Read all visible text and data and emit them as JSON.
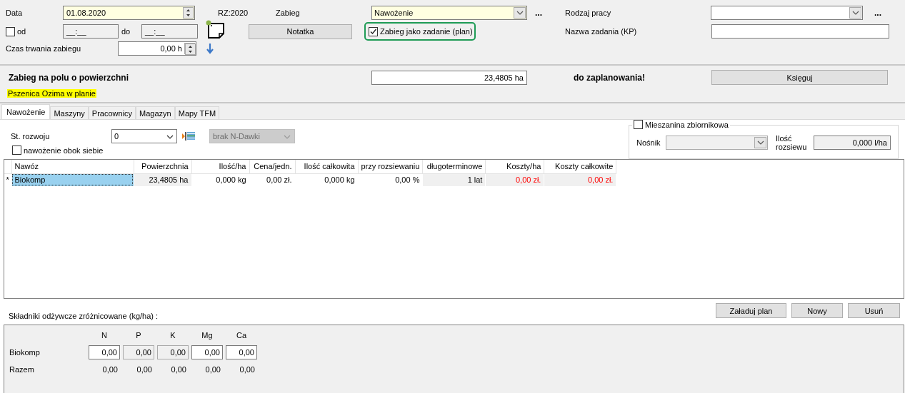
{
  "form": {
    "date": {
      "label": "Data",
      "value": "01.08.2020"
    },
    "year": "RZ:2020",
    "treatment": {
      "label": "Zabieg",
      "value": "Nawożenie",
      "more": "..."
    },
    "work_type": {
      "label": "Rodzaj pracy",
      "more": "..."
    },
    "from": {
      "label": "od",
      "checked": false,
      "value": "__:__"
    },
    "to": {
      "label": "do",
      "value": "__:__"
    },
    "note_button": "Notatka",
    "as_task": {
      "label": "Zabieg jako zadanie (plan)",
      "checked": true
    },
    "task_name": {
      "label": "Nazwa zadania (KP)"
    },
    "duration": {
      "label": "Czas trwania zabiegu",
      "value": "0,00 h"
    }
  },
  "area": {
    "label": "Zabieg na polu o powierzchni",
    "value": "23,4805 ha",
    "status": "do zaplanowania!",
    "post_button": "Księguj",
    "crop": "Pszenica Ozima w planie"
  },
  "tabs": [
    {
      "label": "Nawożenie",
      "selected": true
    },
    {
      "label": "Maszyny",
      "selected": false
    },
    {
      "label": "Pracownicy",
      "selected": false
    },
    {
      "label": "Magazyn",
      "selected": false
    },
    {
      "label": "Mapy TFM",
      "selected": false
    }
  ],
  "fertilization": {
    "growth_stage": {
      "label": "St. rozwoju",
      "value": "0"
    },
    "n_dose": {
      "value": "brak N-Dawki",
      "disabled": true
    },
    "side_by_side": {
      "label": "nawożenie obok siebie",
      "checked": false
    },
    "tank_mix": {
      "label": "Mieszanina zbiornikowa",
      "checked": false,
      "carrier_label": "Nośnik",
      "amount_label": "Ilość rozsiewu",
      "amount": "0,000 l/ha"
    }
  },
  "table": {
    "columns": [
      "Nawóz",
      "Powierzchnia",
      "Ilość/ha",
      "Cena/jedn.",
      "Ilość całkowita",
      "przy rozsiewaniu",
      "długoterminowe",
      "Koszty/ha",
      "Koszty całkowite"
    ],
    "rows": [
      {
        "marker": "*",
        "cells": [
          {
            "text": "Biokomp",
            "kind": "selected"
          },
          {
            "text": "23,4805 ha",
            "kind": "readonly"
          },
          {
            "text": "0,000 kg",
            "kind": "editable"
          },
          {
            "text": "0,00 zł.",
            "kind": "editable"
          },
          {
            "text": "0,000 kg",
            "kind": "editable"
          },
          {
            "text": "0,00 %",
            "kind": "editable"
          },
          {
            "text": "1 lat",
            "kind": "readonly"
          },
          {
            "text": "0,00 zł.",
            "kind": "cost"
          },
          {
            "text": "0,00 zł.",
            "kind": "cost"
          }
        ]
      }
    ]
  },
  "nutrients": {
    "title": "Składniki odżywcze zróżnicowane (kg/ha) :",
    "columns": [
      "N",
      "P",
      "K",
      "Mg",
      "Ca"
    ],
    "rows": [
      {
        "label": "Biokomp",
        "kind": "input",
        "values": [
          {
            "value": "0,00",
            "disabled": false
          },
          {
            "value": "0,00",
            "disabled": true
          },
          {
            "value": "0,00",
            "disabled": true
          },
          {
            "value": "0,00",
            "disabled": false
          },
          {
            "value": "0,00",
            "disabled": false
          }
        ]
      },
      {
        "label": "Razem",
        "kind": "total",
        "values": [
          {
            "value": "0,00",
            "disabled": false
          },
          {
            "value": "0,00",
            "disabled": false
          },
          {
            "value": "0,00",
            "disabled": false
          },
          {
            "value": "0,00",
            "disabled": false
          },
          {
            "value": "0,00",
            "disabled": false
          }
        ]
      }
    ]
  },
  "buttons": [
    "Załaduj plan",
    "Nowy",
    "Usuń"
  ]
}
